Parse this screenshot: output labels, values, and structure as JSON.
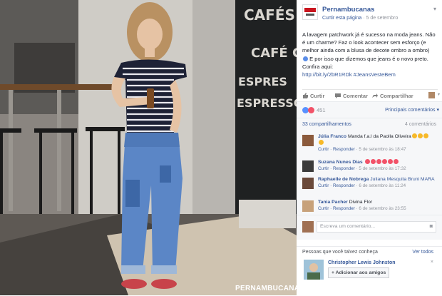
{
  "photo": {
    "chalkboard_lines": [
      "CAFÉS",
      "CAFÉ GEL",
      "ESPRES",
      "ESPRESSO D"
    ],
    "watermark": "PERNAMBUCANAS"
  },
  "post": {
    "page_name": "Pernambucanas",
    "follow_label": "Curtir esta página",
    "date": "5 de setembro",
    "text": "A lavagem patchwork já é sucesso na moda jeans. Não é um charme? Faz o look acontecer sem esforço (e melhor ainda com a blusa de decote ombro a ombro) ",
    "text_after_icon": " E por isso que dizemos que jeans é o novo preto. Confira aqui:",
    "link": "http://bit.ly/2bR1RDk #JeansVesteBem",
    "heart_icon": "blue-heart-icon"
  },
  "actions": {
    "like": "Curtir",
    "comment": "Comentar",
    "share": "Compartilhar"
  },
  "reactions": {
    "count": "451",
    "sort_label": "Principais comentários ▾"
  },
  "stats": {
    "shares": "33 compartilhamentos",
    "comments": "4 comentários"
  },
  "comments": [
    {
      "author": "Júlia Franco",
      "text": "Manda f.a.l da Paolla Oliveira",
      "emoji_icon": "smiling-emoji-icon",
      "reply": "Curtir · Responder",
      "time": "5 de setembro às 18:47",
      "avatar_color": "#8b5a3c"
    },
    {
      "author": "Suzana Nunes Dias",
      "text": "",
      "emoji_icon": "heart-emoji-icon",
      "reply": "Curtir · Responder",
      "time": "5 de setembro às 17:32",
      "avatar_color": "#3b3b3b"
    },
    {
      "author": "Raphaelle de Nobrega",
      "text": "Juliana Mesquita Bruni MARA",
      "emoji_icon": "",
      "reply": "Curtir · Responder",
      "time": "6 de setembro às 11:24",
      "avatar_color": "#6b4a3a"
    },
    {
      "author": "Tania Pacher",
      "text": "Divina Flor",
      "emoji_icon": "",
      "reply": "Curtir · Responder",
      "time": "6 de setembro às 23:55",
      "avatar_color": "#c7a17a"
    }
  ],
  "write": {
    "placeholder": "Escreva um comentário..."
  },
  "people": {
    "title": "Pessoas que você talvez conheça",
    "see_all": "Ver todos",
    "name": "Christopher Lewis Johnston",
    "add_label": "Adicionar aos amigos"
  }
}
